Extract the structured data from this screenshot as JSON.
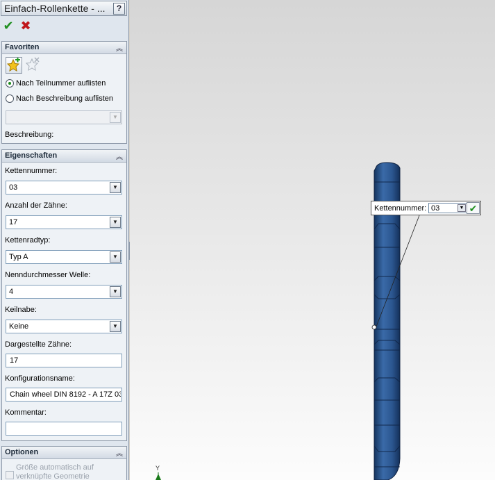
{
  "panel": {
    "title": "Einfach-Rollenkette - ...",
    "help_label": "?",
    "ok_glyph": "✔",
    "cancel_glyph": "✖"
  },
  "favoriten": {
    "heading": "Favoriten",
    "collapse_glyph": "︽",
    "radio_part_number": "Nach Teilnummer auflisten",
    "radio_description": "Nach Beschreibung auflisten",
    "selected": "part_number",
    "favorites_select_value": "",
    "description_label": "Beschreibung:"
  },
  "eigenschaften": {
    "heading": "Eigenschaften",
    "collapse_glyph": "︽",
    "chain_number_label": "Kettennummer:",
    "chain_number_value": "03",
    "teeth_label": "Anzahl der Zähne:",
    "teeth_value": "17",
    "wheel_type_label": "Kettenradtyp:",
    "wheel_type_value": "Typ A",
    "shaft_label": "Nenndurchmesser Welle:",
    "shaft_value": "4",
    "hub_label": "Keilnabe:",
    "hub_value": "Keine",
    "shown_teeth_label": "Dargestellte Zähne:",
    "shown_teeth_value": "17",
    "config_label": "Konfigurationsname:",
    "config_value": "Chain wheel DIN 8192 - A 17Z 03",
    "comment_label": "Kommentar:",
    "comment_value": ""
  },
  "optionen": {
    "heading": "Optionen",
    "collapse_glyph": "︽",
    "auto_size_label_line1": "Größe automatisch auf",
    "auto_size_label_line2": "verknüpfte Geometrie"
  },
  "viewport": {
    "callout_label": "Kettennummer:",
    "callout_value": "03",
    "callout_ok_glyph": "✔",
    "axis_label": "Y"
  },
  "colors": {
    "sprocket_fill": "#2b568f",
    "accent_green": "#1f8f1f",
    "cancel_red": "#c0161b"
  }
}
